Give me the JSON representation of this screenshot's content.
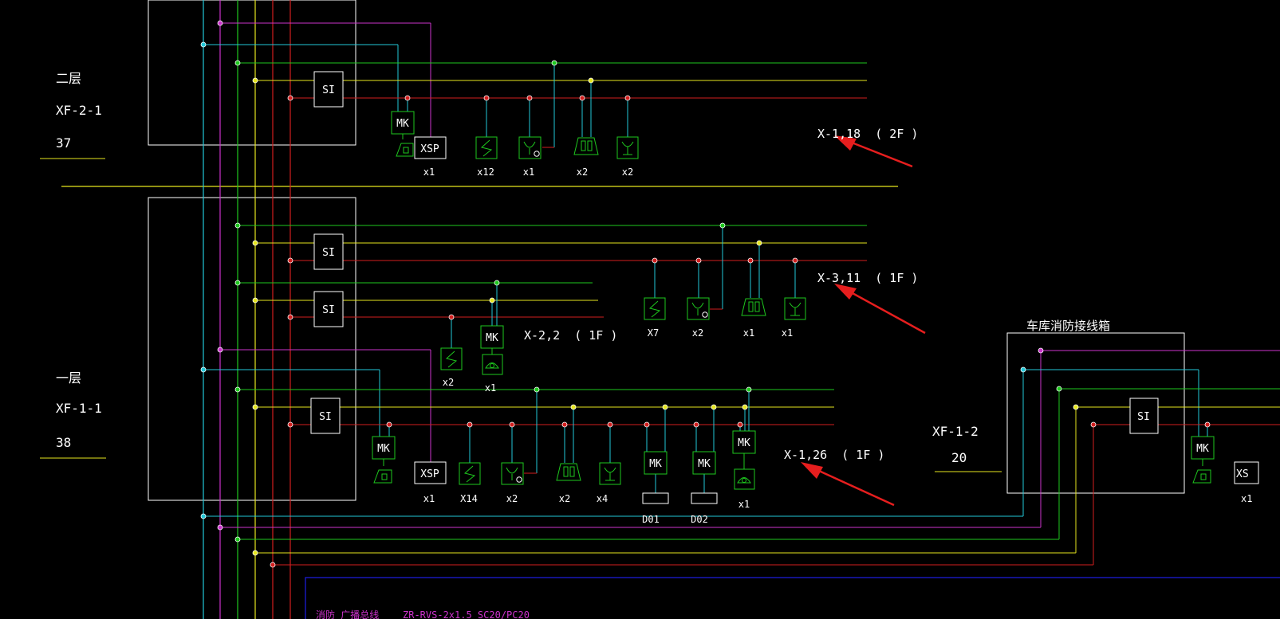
{
  "colors": {
    "background": "#000000",
    "cyan": "#22c8d8",
    "magenta": "#cc33cc",
    "green": "#1ec81e",
    "yellow": "#e6e61e",
    "red": "#d21e1e",
    "white": "#ffffff",
    "blue": "#1e1ee6",
    "arrow": "#e61e1e"
  },
  "floors": {
    "second": {
      "name": "二层",
      "box_id": "XF-2-1",
      "count": "37"
    },
    "first": {
      "name": "一层",
      "box_id": "XF-1-1",
      "count": "38"
    },
    "garage": {
      "title": "车库消防接线箱",
      "box_id": "XF-1-2",
      "count": "20"
    }
  },
  "module_labels": {
    "si": "SI",
    "mk": "MK",
    "xsp": "XSP"
  },
  "circuits": {
    "x1_18": "X-1,18  ( 2F )",
    "x3_11": "X-3,11  ( 1F )",
    "x2_2": "X-2,2  ( 1F )",
    "x1_26": "X-1,26  ( 1F )"
  },
  "quantities": {
    "floor2": {
      "xsp": "x1",
      "flow": "x12",
      "smoke_co": "x1",
      "hand": "x2",
      "heat": "x2"
    },
    "x311": {
      "flow": "X7",
      "smoke_co": "x2",
      "hand": "x1",
      "heat": "x1"
    },
    "x22": {
      "flow": "x2",
      "phone": "x1"
    },
    "floor1": {
      "xsp": "x1",
      "flow": "X14",
      "smoke_co": "x2",
      "hand": "x2",
      "heat": "x4",
      "phone": "x1"
    },
    "garage": {
      "xsp_partial": "x1"
    }
  },
  "devices": {
    "d01": "D01",
    "d02": "D02"
  },
  "partial_labels": {
    "garage_xsp": "XS"
  },
  "legend_partial": {
    "label": "消防 广播总线",
    "cable": "ZR-RVS-2x1.5 SC20/PC20"
  }
}
